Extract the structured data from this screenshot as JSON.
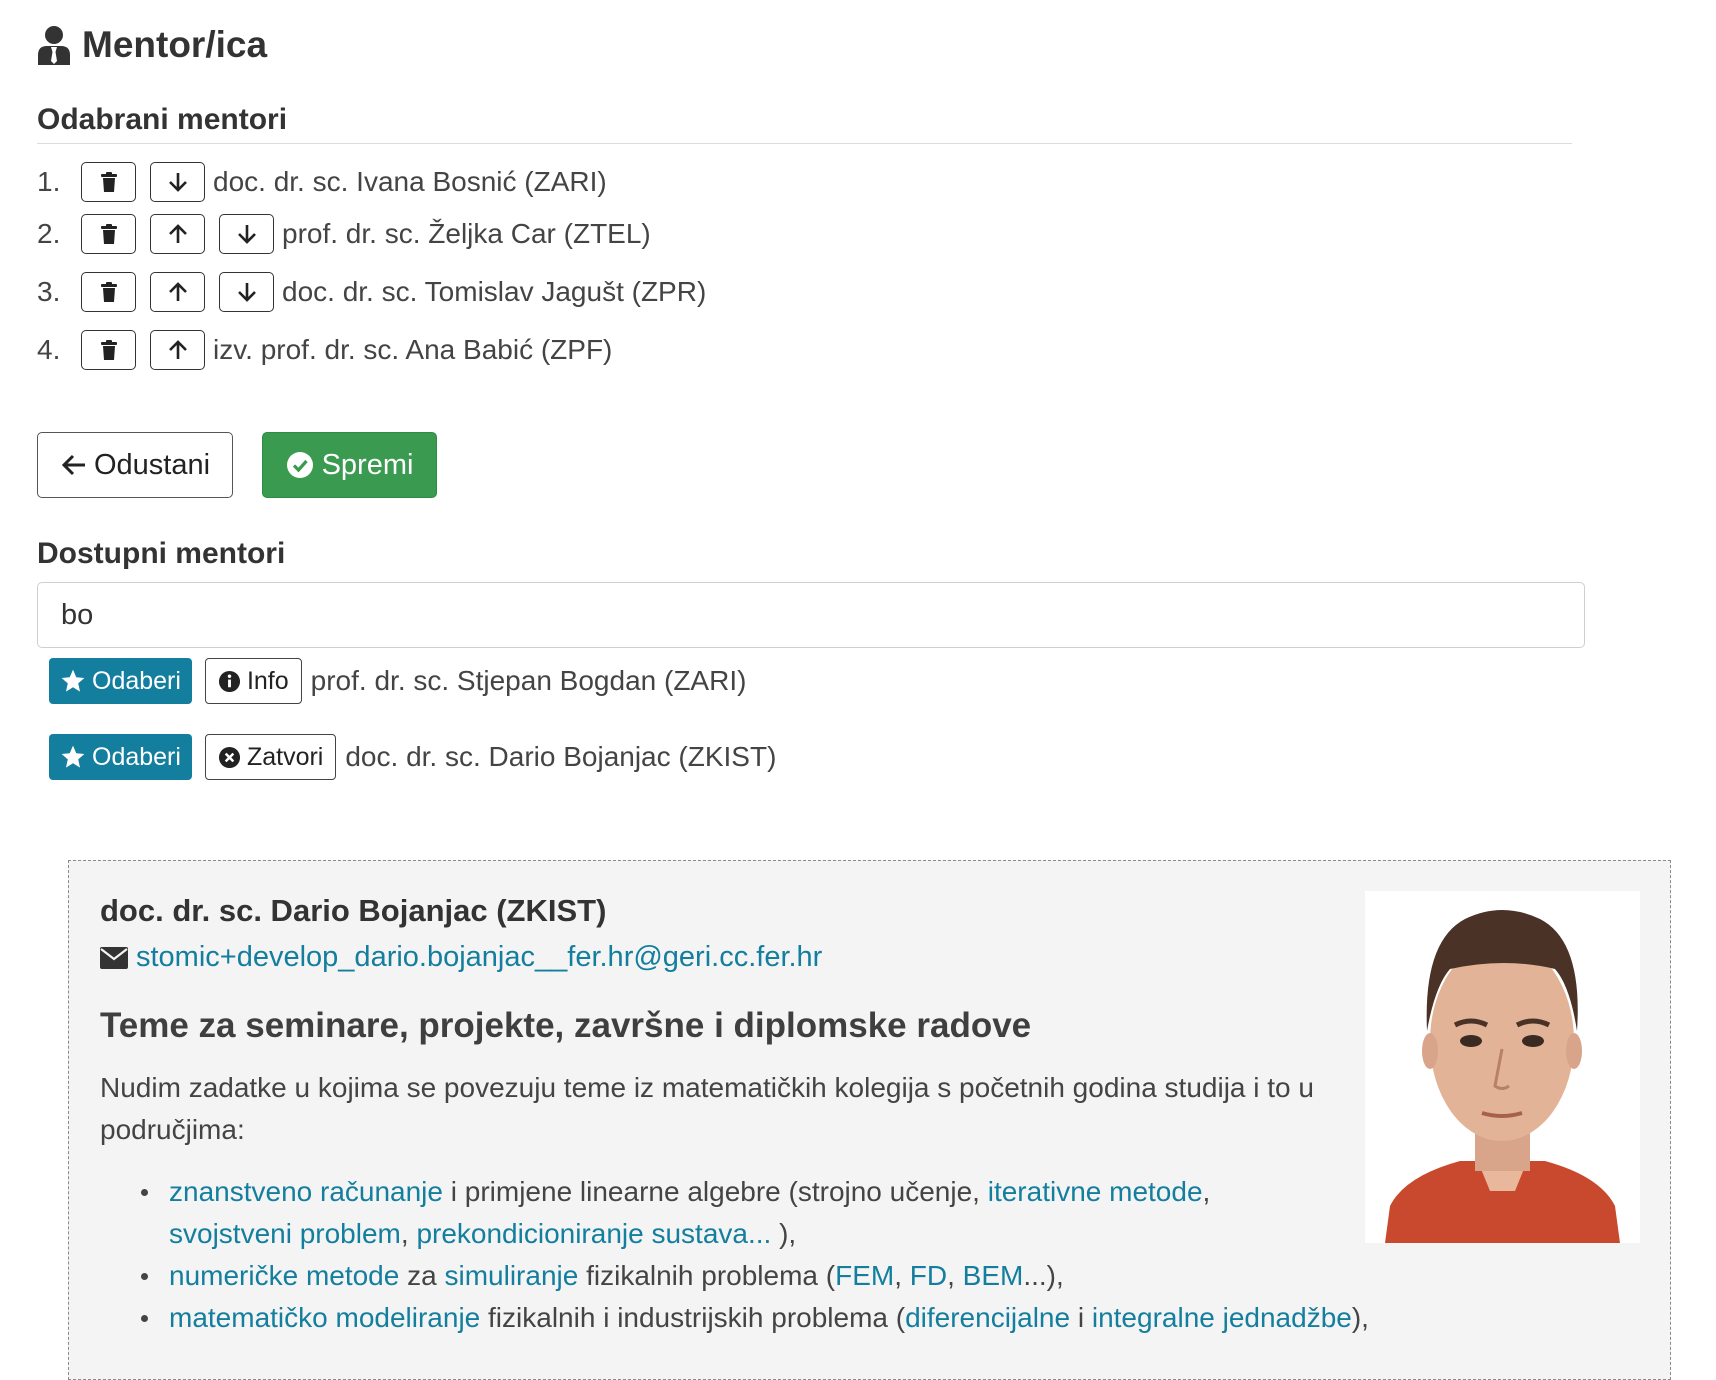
{
  "page": {
    "title": "Mentor/ica",
    "title_icon": "user-tie-icon"
  },
  "selected": {
    "heading": "Odabrani mentori",
    "items": [
      {
        "num": "1.",
        "name": "doc. dr. sc. Ivana Bosnić (ZARI)"
      },
      {
        "num": "2.",
        "name": "prof. dr. sc. Željka Car (ZTEL)"
      },
      {
        "num": "3.",
        "name": "doc. dr. sc. Tomislav Jagušt (ZPR)"
      },
      {
        "num": "4.",
        "name": "izv. prof. dr. sc. Ana Babić (ZPF)"
      }
    ]
  },
  "actions": {
    "cancel_label": "Odustani",
    "save_label": "Spremi"
  },
  "available": {
    "heading": "Dostupni mentori",
    "search_value": "bo",
    "results": [
      {
        "choose_label": "Odaberi",
        "toggle_label": "Info",
        "name": "prof. dr. sc. Stjepan Bogdan (ZARI)"
      },
      {
        "choose_label": "Odaberi",
        "toggle_label": "Zatvori",
        "name": "doc. dr. sc. Dario Bojanjac (ZKIST)"
      }
    ]
  },
  "details": {
    "name": "doc. dr. sc. Dario Bojanjac (ZKIST)",
    "email": "stomic+develop_dario.bojanjac__fer.hr@geri.cc.fer.hr",
    "topics_title": "Teme za seminare, projekte, završne i diplomske radove",
    "intro": "Nudim zadatke u kojima se povezuju teme iz matematičkih kolegija s početnih godina studija i to u područjima:",
    "topic_1": {
      "link_a": "znanstveno računanje",
      "text_a": " i primjene linearne algebre (strojno učenje, ",
      "link_b": "iterativne metode",
      "text_b": ",",
      "link_c": "svojstveni problem",
      "text_c": ", ",
      "link_d": "prekondicioniranje sustava...",
      "text_d": " ),"
    },
    "topic_2": {
      "link_a": "numeričke metode",
      "text_a": " za ",
      "link_b": "simuliranje",
      "text_b": " fizikalnih problema (",
      "link_c": "FEM",
      "text_c": ", ",
      "link_d": "FD",
      "text_d": ", ",
      "link_e": "BEM",
      "text_e": "...),"
    },
    "topic_3": {
      "link_a": "matematičko modeliranje",
      "text_a": " fizikalnih i industrijskih problema (",
      "link_b": "diferencijalne",
      "text_b": " i ",
      "link_c": "integralne jednadžbe",
      "text_c": "),"
    }
  },
  "colors": {
    "primary": "#137e9e",
    "success": "#3a9a4f",
    "panel_bg": "#f4f4f4",
    "text": "#333333"
  }
}
